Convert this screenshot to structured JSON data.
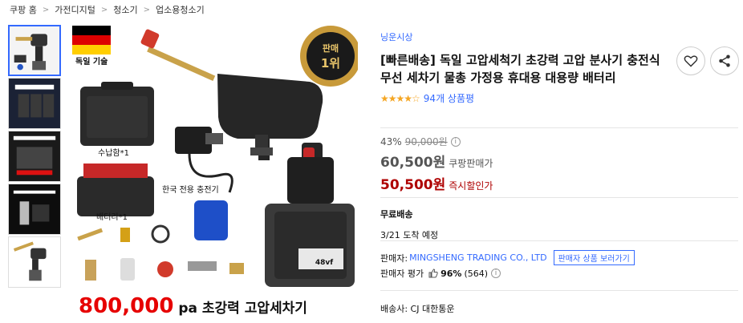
{
  "breadcrumb": {
    "items": [
      "쿠팡 홈",
      "가전디지털",
      "청소기",
      "업소용청소기"
    ],
    "separator": ">"
  },
  "gallery": {
    "thumbnail_count": 5,
    "active_index": 0
  },
  "hero_image": {
    "badge_top": "판매",
    "badge_rank": "1위",
    "germany_label": "독일 기술",
    "case_label": "수납함*1",
    "battery_label": "배터리*1",
    "charger_label": "한국 전용 충전기",
    "banner_number": "800,000",
    "banner_text": " pa 초강력 고압세차기",
    "battery_voltage": "48vf",
    "colors": {
      "banner_number": "#e60000",
      "flag_black": "#000000",
      "flag_red": "#dd0000",
      "flag_gold": "#ffce00"
    }
  },
  "product": {
    "brand": "닝운시상",
    "title": "[빠른배송] 독일 고압세척기 초강력 고압 분사기 충전식 무선 세차기 물총 가정용 휴대용 대용량 배터리",
    "stars": "★★★★☆",
    "rating": 4,
    "review_count": "94개 상품평"
  },
  "actions": {
    "wishlist_icon": "heart-icon",
    "share_icon": "share-icon"
  },
  "price": {
    "discount_rate": "43%",
    "original_price": "90,000원",
    "info_icon": "i",
    "coupang_price": "60,500원",
    "coupang_price_label": "쿠팡판매가",
    "instant_price": "50,500원",
    "instant_price_label": "즉시할인가",
    "colors": {
      "instant": "#ae0000",
      "accent": "#346aff"
    }
  },
  "shipping": {
    "label": "무료배송",
    "arrival": "3/21 도착 예정"
  },
  "seller": {
    "label": "판매자: ",
    "name": "MINGSHENG TRADING CO., LTD",
    "button": "판매자 상품 보러가기",
    "rating_label": "판매자 평가",
    "rating_pct": "96%",
    "rating_count": "(564)",
    "info_icon": "i"
  },
  "delivery": {
    "text": "배송사: CJ 대한통운"
  }
}
